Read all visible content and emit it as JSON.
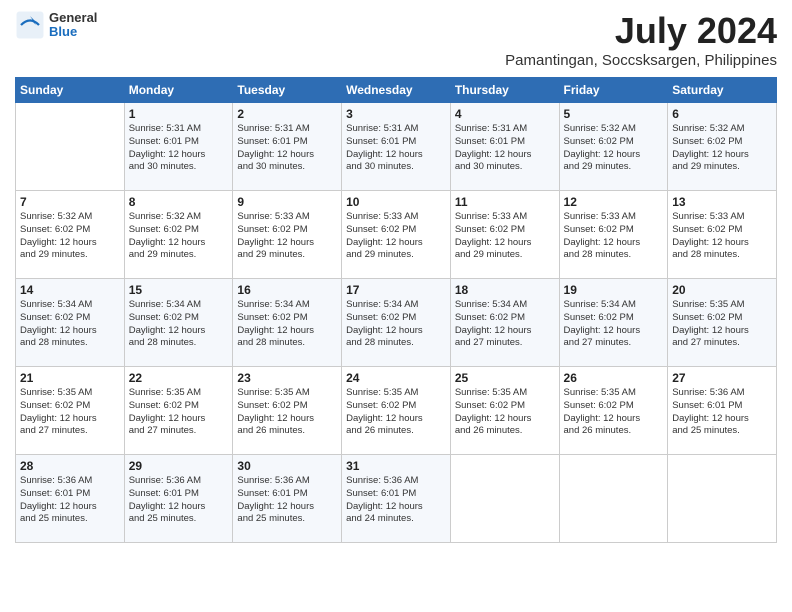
{
  "header": {
    "logo_general": "General",
    "logo_blue": "Blue",
    "month_year": "July 2024",
    "location": "Pamantingan, Soccsksargen, Philippines"
  },
  "days_of_week": [
    "Sunday",
    "Monday",
    "Tuesday",
    "Wednesday",
    "Thursday",
    "Friday",
    "Saturday"
  ],
  "weeks": [
    [
      {
        "day": "",
        "info": ""
      },
      {
        "day": "1",
        "info": "Sunrise: 5:31 AM\nSunset: 6:01 PM\nDaylight: 12 hours\nand 30 minutes."
      },
      {
        "day": "2",
        "info": "Sunrise: 5:31 AM\nSunset: 6:01 PM\nDaylight: 12 hours\nand 30 minutes."
      },
      {
        "day": "3",
        "info": "Sunrise: 5:31 AM\nSunset: 6:01 PM\nDaylight: 12 hours\nand 30 minutes."
      },
      {
        "day": "4",
        "info": "Sunrise: 5:31 AM\nSunset: 6:01 PM\nDaylight: 12 hours\nand 30 minutes."
      },
      {
        "day": "5",
        "info": "Sunrise: 5:32 AM\nSunset: 6:02 PM\nDaylight: 12 hours\nand 29 minutes."
      },
      {
        "day": "6",
        "info": "Sunrise: 5:32 AM\nSunset: 6:02 PM\nDaylight: 12 hours\nand 29 minutes."
      }
    ],
    [
      {
        "day": "7",
        "info": "Sunrise: 5:32 AM\nSunset: 6:02 PM\nDaylight: 12 hours\nand 29 minutes."
      },
      {
        "day": "8",
        "info": "Sunrise: 5:32 AM\nSunset: 6:02 PM\nDaylight: 12 hours\nand 29 minutes."
      },
      {
        "day": "9",
        "info": "Sunrise: 5:33 AM\nSunset: 6:02 PM\nDaylight: 12 hours\nand 29 minutes."
      },
      {
        "day": "10",
        "info": "Sunrise: 5:33 AM\nSunset: 6:02 PM\nDaylight: 12 hours\nand 29 minutes."
      },
      {
        "day": "11",
        "info": "Sunrise: 5:33 AM\nSunset: 6:02 PM\nDaylight: 12 hours\nand 29 minutes."
      },
      {
        "day": "12",
        "info": "Sunrise: 5:33 AM\nSunset: 6:02 PM\nDaylight: 12 hours\nand 28 minutes."
      },
      {
        "day": "13",
        "info": "Sunrise: 5:33 AM\nSunset: 6:02 PM\nDaylight: 12 hours\nand 28 minutes."
      }
    ],
    [
      {
        "day": "14",
        "info": "Sunrise: 5:34 AM\nSunset: 6:02 PM\nDaylight: 12 hours\nand 28 minutes."
      },
      {
        "day": "15",
        "info": "Sunrise: 5:34 AM\nSunset: 6:02 PM\nDaylight: 12 hours\nand 28 minutes."
      },
      {
        "day": "16",
        "info": "Sunrise: 5:34 AM\nSunset: 6:02 PM\nDaylight: 12 hours\nand 28 minutes."
      },
      {
        "day": "17",
        "info": "Sunrise: 5:34 AM\nSunset: 6:02 PM\nDaylight: 12 hours\nand 28 minutes."
      },
      {
        "day": "18",
        "info": "Sunrise: 5:34 AM\nSunset: 6:02 PM\nDaylight: 12 hours\nand 27 minutes."
      },
      {
        "day": "19",
        "info": "Sunrise: 5:34 AM\nSunset: 6:02 PM\nDaylight: 12 hours\nand 27 minutes."
      },
      {
        "day": "20",
        "info": "Sunrise: 5:35 AM\nSunset: 6:02 PM\nDaylight: 12 hours\nand 27 minutes."
      }
    ],
    [
      {
        "day": "21",
        "info": "Sunrise: 5:35 AM\nSunset: 6:02 PM\nDaylight: 12 hours\nand 27 minutes."
      },
      {
        "day": "22",
        "info": "Sunrise: 5:35 AM\nSunset: 6:02 PM\nDaylight: 12 hours\nand 27 minutes."
      },
      {
        "day": "23",
        "info": "Sunrise: 5:35 AM\nSunset: 6:02 PM\nDaylight: 12 hours\nand 26 minutes."
      },
      {
        "day": "24",
        "info": "Sunrise: 5:35 AM\nSunset: 6:02 PM\nDaylight: 12 hours\nand 26 minutes."
      },
      {
        "day": "25",
        "info": "Sunrise: 5:35 AM\nSunset: 6:02 PM\nDaylight: 12 hours\nand 26 minutes."
      },
      {
        "day": "26",
        "info": "Sunrise: 5:35 AM\nSunset: 6:02 PM\nDaylight: 12 hours\nand 26 minutes."
      },
      {
        "day": "27",
        "info": "Sunrise: 5:36 AM\nSunset: 6:01 PM\nDaylight: 12 hours\nand 25 minutes."
      }
    ],
    [
      {
        "day": "28",
        "info": "Sunrise: 5:36 AM\nSunset: 6:01 PM\nDaylight: 12 hours\nand 25 minutes."
      },
      {
        "day": "29",
        "info": "Sunrise: 5:36 AM\nSunset: 6:01 PM\nDaylight: 12 hours\nand 25 minutes."
      },
      {
        "day": "30",
        "info": "Sunrise: 5:36 AM\nSunset: 6:01 PM\nDaylight: 12 hours\nand 25 minutes."
      },
      {
        "day": "31",
        "info": "Sunrise: 5:36 AM\nSunset: 6:01 PM\nDaylight: 12 hours\nand 24 minutes."
      },
      {
        "day": "",
        "info": ""
      },
      {
        "day": "",
        "info": ""
      },
      {
        "day": "",
        "info": ""
      }
    ]
  ]
}
